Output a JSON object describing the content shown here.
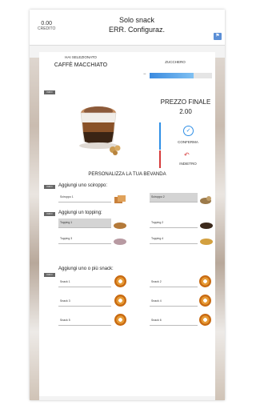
{
  "topbar": {
    "credit_value": "0.00",
    "credit_label": "CREDITO",
    "title_line1": "Solo snack",
    "title_line2": "ERR. Configuraz.",
    "flag_icon": "flag-icon"
  },
  "product": {
    "selected_label": "HAI SELEZIONATO",
    "name": "CAFFÈ MACCHIATO",
    "tag": "INFO"
  },
  "sugar": {
    "label": "ZUCCHERO",
    "level": 0.7,
    "minus": "−"
  },
  "price": {
    "title": "PREZZO FINALE",
    "value": "2.00"
  },
  "actions": {
    "confirm_label": "CONFERMA",
    "back_label": "INDIETRO"
  },
  "customize": {
    "title": "PERSONALIZZA LA TUA BEVANDA",
    "syrup": {
      "title": "Aggiungi uno sciroppo:",
      "tag": "INFO",
      "items": [
        "Sciroppo 1",
        "Sciroppo 2"
      ]
    },
    "topping": {
      "title": "Aggiungi un topping:",
      "tag": "INFO",
      "items": [
        "Topping 1",
        "Topping 2",
        "Topping 3",
        "Topping 4"
      ]
    },
    "snack": {
      "title": "Aggiungi uno o più snack:",
      "tag": "INFO",
      "items": [
        "Snack 1",
        "Snack 2",
        "Snack 3",
        "Snack 4",
        "Snack 5",
        "Snack 6"
      ]
    }
  },
  "colors": {
    "accent": "#2f8fe6",
    "back": "#d63b3b"
  }
}
